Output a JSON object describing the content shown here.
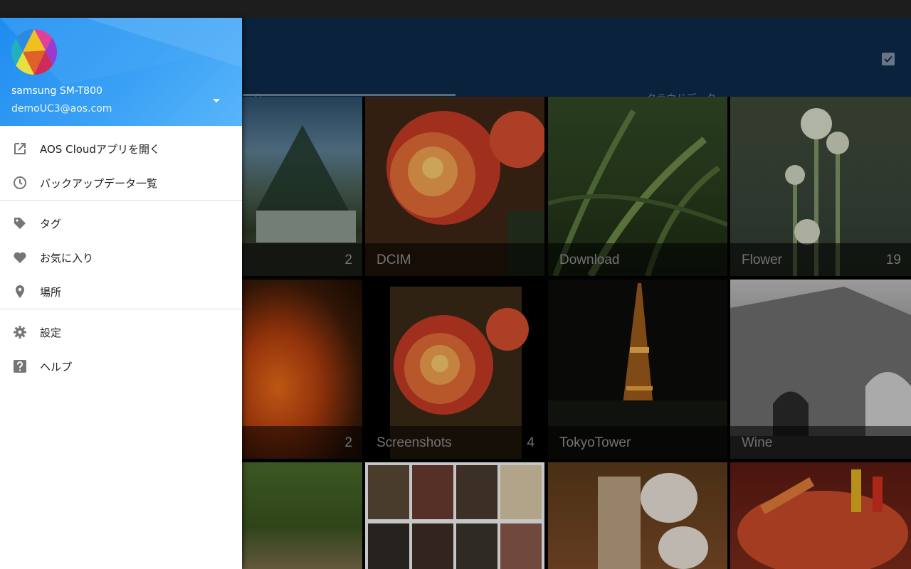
{
  "app_bar": {
    "tabs": [
      {
        "label": "ータ"
      },
      {
        "label": "クラウドデータ"
      }
    ]
  },
  "account": {
    "name": "samsung SM-T800",
    "email": "demoUC3@aos.com"
  },
  "menu": [
    {
      "label": "AOS Cloudアプリを開く",
      "icon": "open-in-new-icon"
    },
    {
      "label": "バックアップデータ一覧",
      "icon": "history-icon"
    },
    {
      "label": "タグ",
      "icon": "tag-icon"
    },
    {
      "label": "お気に入り",
      "icon": "heart-icon"
    },
    {
      "label": "場所",
      "icon": "location-pin-icon"
    },
    {
      "label": "設定",
      "icon": "gear-icon"
    },
    {
      "label": "ヘルプ",
      "icon": "help-icon"
    }
  ],
  "albums": [
    {
      "name": "",
      "count": "2"
    },
    {
      "name": "DCIM",
      "count": ""
    },
    {
      "name": "Download",
      "count": ""
    },
    {
      "name": "Flower",
      "count": "19"
    },
    {
      "name": "",
      "count": "2"
    },
    {
      "name": "Screenshots",
      "count": "4"
    },
    {
      "name": "TokyoTower",
      "count": ""
    },
    {
      "name": "Wine",
      "count": ""
    },
    {
      "name": "",
      "count": ""
    },
    {
      "name": "",
      "count": ""
    },
    {
      "name": "",
      "count": ""
    },
    {
      "name": "",
      "count": ""
    }
  ],
  "colors": {
    "drawer_header": "#1e8bf0",
    "app_bar": "#0d2a49",
    "status_bar": "#1d1d1d"
  }
}
